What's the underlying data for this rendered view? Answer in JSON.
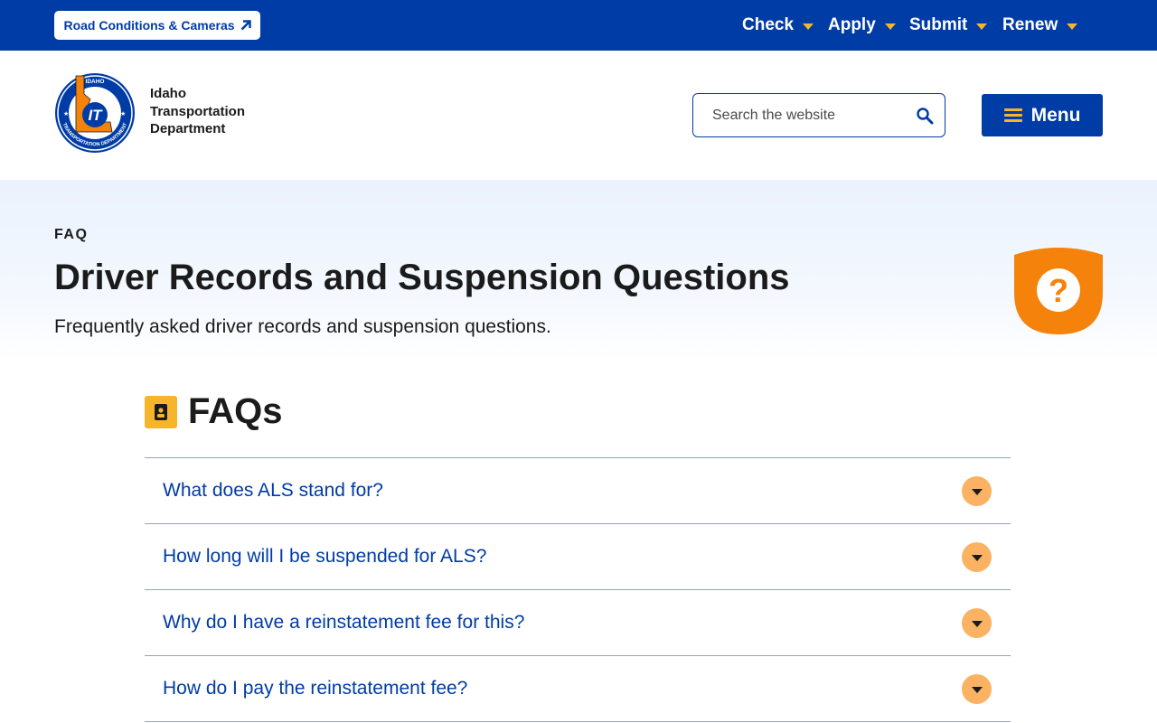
{
  "topbar": {
    "road_conditions_label": "Road Conditions & Cameras",
    "nav": [
      {
        "label": "Check"
      },
      {
        "label": "Apply"
      },
      {
        "label": "Submit"
      },
      {
        "label": "Renew"
      }
    ]
  },
  "header": {
    "logo": {
      "outer_text": "IDAHO",
      "ring_text": "TRANSPORTATION DEPARTMENT",
      "initials": "IT"
    },
    "brand_lines": [
      "Idaho",
      "Transportation",
      "Department"
    ],
    "search": {
      "placeholder": "Search the website",
      "value": "",
      "icon": "search-icon"
    },
    "menu_label": "Menu"
  },
  "hero": {
    "eyebrow": "FAQ",
    "title": "Driver Records and Suspension Questions",
    "subtitle": "Frequently asked driver records and suspension questions.",
    "badge_icon": "question-mark-icon"
  },
  "faq": {
    "heading": "FAQs",
    "heading_icon": "contact-card-icon",
    "items": [
      {
        "question": "What does ALS stand for?"
      },
      {
        "question": "How long will I be suspended for ALS?"
      },
      {
        "question": "Why do I have a reinstatement fee for this?"
      },
      {
        "question": "How do I pay the reinstatement fee?"
      }
    ]
  },
  "colors": {
    "primary_blue": "#003ca6",
    "accent_gold": "#f7b52c",
    "accent_orange": "#f5820b",
    "toggle_orange": "#fbb263",
    "hero_bg": "#eaf2fd"
  }
}
